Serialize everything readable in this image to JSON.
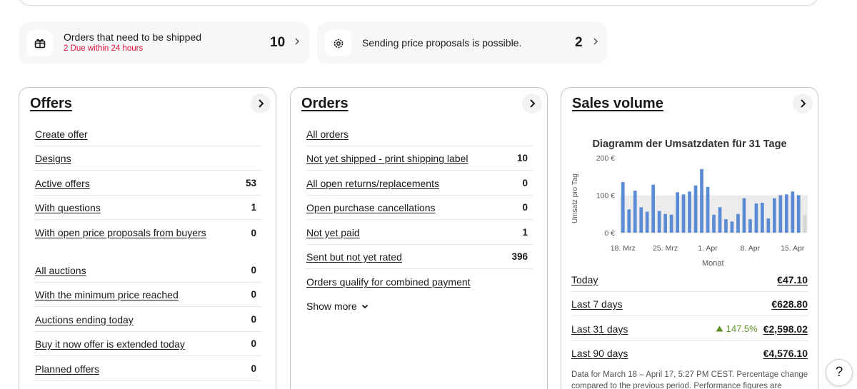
{
  "tiles": {
    "ship": {
      "title": "Orders that need to be shipped",
      "sub": "2 Due within 24 hours",
      "count": "10",
      "icon": "package-icon"
    },
    "proposals": {
      "title": "Sending price proposals is possible.",
      "count": "2",
      "icon": "gear-badge-icon"
    }
  },
  "offers": {
    "title": "Offers",
    "rows": [
      {
        "label": "Create offer",
        "value": ""
      },
      {
        "label": "Designs",
        "value": ""
      },
      {
        "label": "Active offers",
        "value": "53"
      },
      {
        "label": "With questions",
        "value": "1"
      },
      {
        "label": "With open price proposals from buyers",
        "value": "0"
      },
      {
        "label": "All auctions",
        "value": "0"
      },
      {
        "label": "With the minimum price reached",
        "value": "0"
      },
      {
        "label": "Auctions ending today",
        "value": "0"
      },
      {
        "label": "Buy it now offer is extended today",
        "value": "0"
      },
      {
        "label": "Planned offers",
        "value": "0"
      }
    ]
  },
  "orders": {
    "title": "Orders",
    "rows": [
      {
        "label": "All orders",
        "value": ""
      },
      {
        "label": "Not yet shipped - print shipping label",
        "value": "10"
      },
      {
        "label": "All open returns/replacements",
        "value": "0"
      },
      {
        "label": "Open purchase cancellations",
        "value": "0"
      },
      {
        "label": "Not yet paid",
        "value": "1"
      },
      {
        "label": "Sent but not yet rated",
        "value": "396"
      },
      {
        "label": "Orders qualify for combined payment",
        "value": ""
      }
    ],
    "show_more": "Show more"
  },
  "sales": {
    "title": "Sales volume",
    "rows": [
      {
        "label": "Today",
        "amount": "€47.10",
        "trend": ""
      },
      {
        "label": "Last 7 days",
        "amount": "€628.80",
        "trend": ""
      },
      {
        "label": "Last 31 days",
        "amount": "€2,598.02",
        "trend": "147.5%"
      },
      {
        "label": "Last 90 days",
        "amount": "€4,576.10",
        "trend": ""
      }
    ],
    "footnote": "Data for March 18 – April 17, 5:27 PM CEST. Percentage change compared to the previous period. Performance figures are"
  },
  "chart_data": {
    "type": "bar",
    "title": "Diagramm der Umsatzdaten für 31 Tage",
    "xlabel": "Monat",
    "ylabel": "Umsatz pro Tag",
    "y_ticks": [
      "200 €",
      "100 €",
      "0 €"
    ],
    "x_ticks": [
      "18. Mrz",
      "25. Mrz",
      "1. Apr",
      "8. Apr",
      "15. Apr"
    ],
    "ylim": [
      0,
      200
    ],
    "values": [
      135,
      62,
      112,
      68,
      56,
      128,
      58,
      50,
      48,
      108,
      102,
      110,
      126,
      170,
      122,
      48,
      68,
      36,
      30,
      50,
      92,
      36,
      78,
      80,
      38,
      92,
      100,
      102,
      110,
      100,
      47
    ],
    "colors": {
      "bar": "#5b8bd4",
      "last_bar": "#d4d4d4",
      "band": "#ececec"
    }
  },
  "help": {
    "label": "?"
  }
}
